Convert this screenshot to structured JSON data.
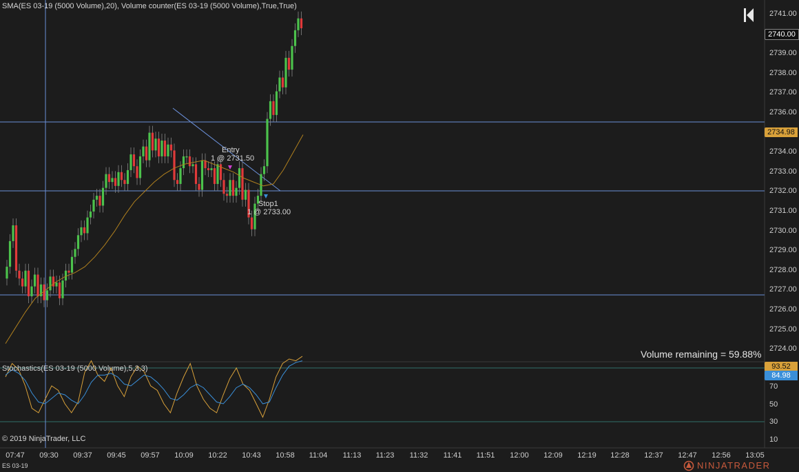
{
  "main_panel": {
    "title": "SMA(ES 03-19 (5000 Volume),20), Volume counter(ES 03-19 (5000 Volume),True,True)",
    "volume_remaining": "Volume remaining = 59.88%",
    "y_ticks": [
      "2741.00",
      "2740.00",
      "2739.00",
      "2738.00",
      "2737.00",
      "2736.00",
      "2735.00",
      "2734.00",
      "2733.00",
      "2732.00",
      "2731.00",
      "2730.00",
      "2729.00",
      "2728.00",
      "2727.00",
      "2726.00",
      "2725.00",
      "2724.00"
    ],
    "last_price_badge": "2740.00",
    "line_price_badge": "2734.98",
    "trades": {
      "entry_label": "Entry",
      "entry_detail": "1 @ 2731.50",
      "stop_label": "Stop1",
      "stop_detail": "1 @ 2733.00"
    }
  },
  "stoch_panel": {
    "title": "Stochastics(ES 03-19 (5000 Volume),5,3,3)",
    "y_ticks": [
      "70",
      "50",
      "30",
      "10"
    ],
    "d_badge": "93.52",
    "k_badge": "84.98",
    "copyright": "© 2019 NinjaTrader, LLC"
  },
  "x_axis": {
    "ticks": [
      "07:47",
      "09:30",
      "09:37",
      "09:45",
      "09:57",
      "10:09",
      "10:22",
      "10:43",
      "10:58",
      "11:04",
      "11:13",
      "11:23",
      "11:32",
      "11:41",
      "11:51",
      "12:00",
      "12:09",
      "12:19",
      "12:28",
      "12:37",
      "12:47",
      "12:56",
      "13:05"
    ]
  },
  "footer": {
    "instrument_tab": "ES 03-19",
    "brand": "NINJATRADER"
  },
  "colors": {
    "up_candle": "#4cc24c",
    "down_candle": "#e03a3a",
    "sma_line": "#b0801e",
    "horizontal_lines": "#6a8fd8",
    "stoch_d": "#d9a13a",
    "stoch_k": "#3a8fd9"
  },
  "icons": {
    "collapse_panel": "skip-back-icon"
  }
}
